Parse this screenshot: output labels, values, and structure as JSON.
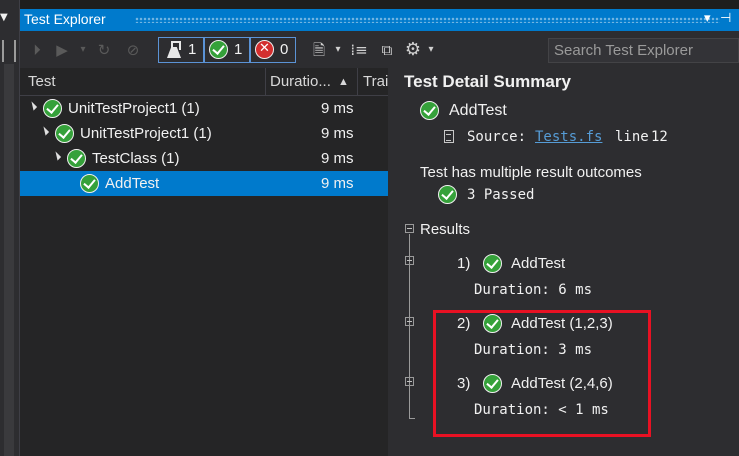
{
  "window": {
    "title": "Test Explorer"
  },
  "toolbar": {
    "total_count": "1",
    "passed_count": "1",
    "failed_count": "0",
    "search_placeholder": "Search Test Explorer"
  },
  "tree": {
    "columns": [
      "Test",
      "Duratio...",
      "Trai"
    ],
    "rows": [
      {
        "name": "UnitTestProject1 (1)",
        "duration": "9 ms"
      },
      {
        "name": "UnitTestProject1 (1)",
        "duration": "9 ms"
      },
      {
        "name": "TestClass (1)",
        "duration": "9 ms"
      },
      {
        "name": "AddTest",
        "duration": "9 ms"
      }
    ]
  },
  "detail": {
    "heading": "Test Detail Summary",
    "test_name": "AddTest",
    "source_label": "Source:",
    "source_file": "Tests.fs",
    "source_line_label": "line",
    "source_line": "12",
    "outcomes_text": "Test has multiple result outcomes",
    "passed_summary": "3 Passed",
    "results_label": "Results",
    "results": [
      {
        "index": "1)",
        "name": "AddTest",
        "duration": "Duration: 6 ms"
      },
      {
        "index": "2)",
        "name": "AddTest (1,2,3)",
        "duration": "Duration: 3 ms"
      },
      {
        "index": "3)",
        "name": "AddTest (2,4,6)",
        "duration": "Duration: < 1 ms"
      }
    ]
  },
  "colors": {
    "accent": "#007acc",
    "pass": "#35a13a",
    "fail": "#d32f2f",
    "highlight_box": "#e81123",
    "link": "#569cd6"
  }
}
